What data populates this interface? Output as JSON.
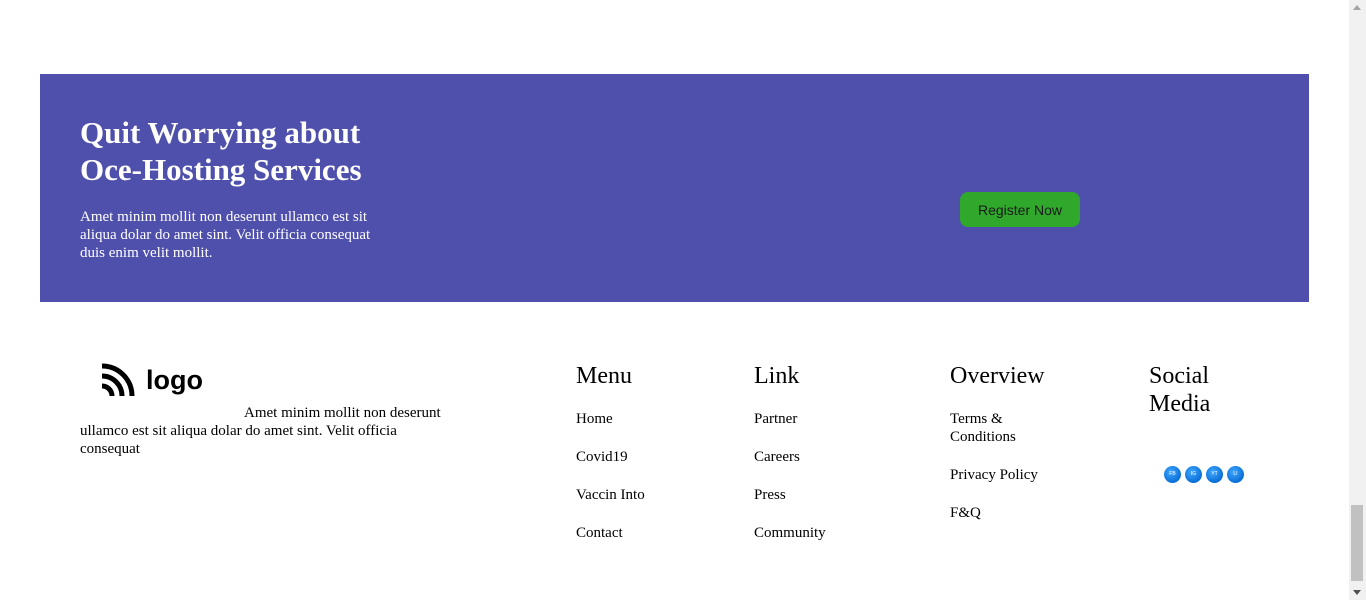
{
  "cta": {
    "title": "Quit Worrying about Oce-Hosting Services",
    "text": "Amet minim mollit non deserunt ullamco est sit aliqua dolar do amet sint. Velit officia consequat duis enim velit mollit.",
    "button_label": "Register Now",
    "background_color": "#4f4fac",
    "button_color": "#2fa82b"
  },
  "footer": {
    "logo_text": "logo",
    "logo_icon": "rss-feed-icon",
    "description": "Amet minim mollit non deserunt ullamco est sit aliqua dolar do amet sint. Velit officia consequat",
    "menu": {
      "heading": "Menu",
      "items": [
        "Home",
        "Covid19",
        "Vaccin Into",
        "Contact"
      ]
    },
    "link": {
      "heading": "Link",
      "items": [
        "Partner",
        "Careers",
        "Press",
        "Community"
      ]
    },
    "overview": {
      "heading": "Overview",
      "items": [
        "Terms & Conditions",
        "Privacy Policy",
        "F&Q"
      ]
    },
    "social": {
      "heading": "Social Media",
      "icons": [
        {
          "label": "FB",
          "icon": "facebook-icon"
        },
        {
          "label": "IG",
          "icon": "instagram-icon"
        },
        {
          "label": "YT",
          "icon": "youtube-icon"
        },
        {
          "label": "LI",
          "icon": "linkedin-icon"
        }
      ],
      "icon_color": "#0a6fd6"
    }
  }
}
